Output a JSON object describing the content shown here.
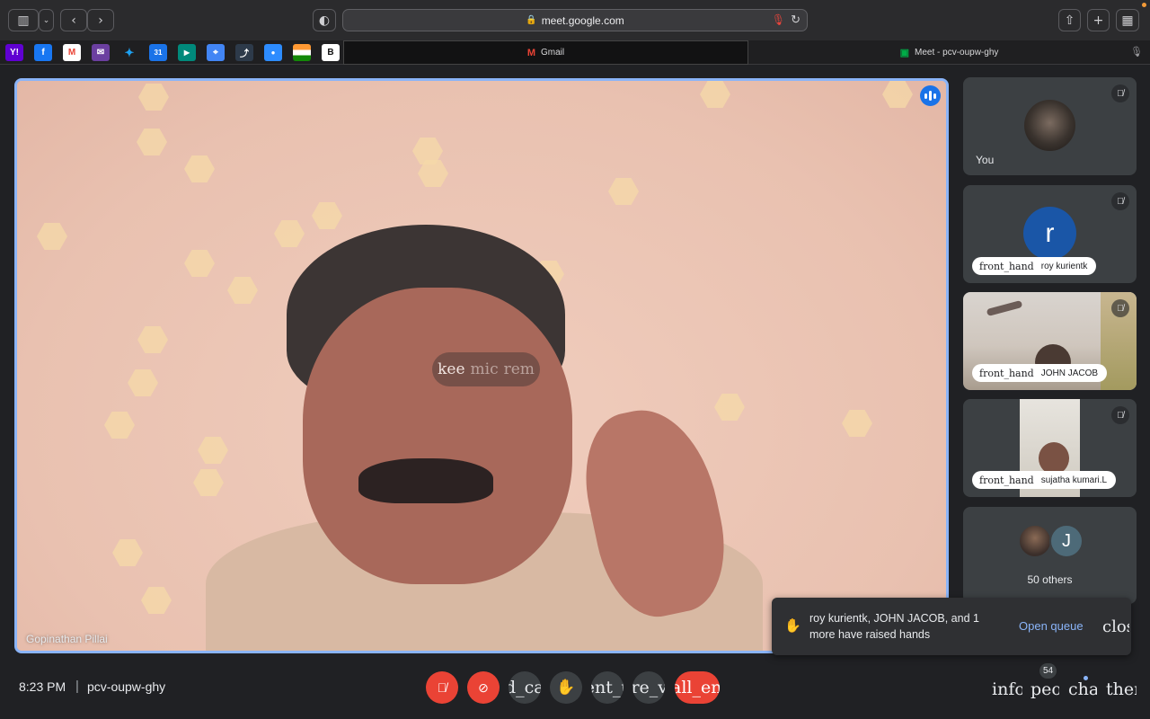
{
  "browser": {
    "url": "meet.google.com",
    "tabs": [
      {
        "label": "Gmail",
        "icon": "M"
      },
      {
        "label": "Meet - pcv-oupw-ghy",
        "icon": "meet-icon"
      }
    ],
    "bookmarks": [
      {
        "name": "yahoo",
        "glyph": "Y!",
        "color": "#6001d2"
      },
      {
        "name": "facebook",
        "glyph": "f",
        "color": "#1877f2"
      },
      {
        "name": "gmail",
        "glyph": "M",
        "color": "#ffffff"
      },
      {
        "name": "mail",
        "glyph": "✉",
        "color": "#6b3fa0"
      },
      {
        "name": "twitter",
        "glyph": "🐦",
        "color": "#1da1f2"
      },
      {
        "name": "calendar",
        "glyph": "31",
        "color": "#1a73e8"
      },
      {
        "name": "meet",
        "glyph": "▶",
        "color": "#00897b"
      },
      {
        "name": "maps",
        "glyph": "⌖",
        "color": "#4285f4"
      },
      {
        "name": "chart",
        "glyph": "⤴",
        "color": "#2d3a4a"
      },
      {
        "name": "zoom",
        "glyph": "●",
        "color": "#2d8cff"
      },
      {
        "name": "india-flag",
        "glyph": "",
        "color": "#ff9933"
      },
      {
        "name": "bold-b",
        "glyph": "B",
        "color": "#ffffff"
      }
    ]
  },
  "meeting": {
    "main_speaker": "Gopinathan Pillai",
    "hint_words": [
      "kee",
      "mic",
      "rem"
    ],
    "participants": [
      {
        "name": "You"
      },
      {
        "name": "roy kurientk",
        "initial": "r",
        "raised": "front_hand"
      },
      {
        "name": "JOHN JACOB",
        "raised": "front_hand"
      },
      {
        "name": "sujatha kumari.L",
        "raised": "front_hand"
      }
    ],
    "others_label": "50 others",
    "others_initial": "J"
  },
  "toast": {
    "message": "roy kurientk, JOHN JACOB, and 1 more have raised hands",
    "action": "Open queue",
    "close": "close"
  },
  "bottom": {
    "time": "8:23 PM",
    "separator": "|",
    "meeting_code": "pcv-oupw-ghy",
    "controls": {
      "cc": "closed_caption",
      "present": "present_to_all",
      "more": "more_vert",
      "end": "call_end"
    },
    "right": {
      "info": "info",
      "people": "people",
      "chat": "chat",
      "activities": "therapy",
      "people_count": "54"
    }
  }
}
